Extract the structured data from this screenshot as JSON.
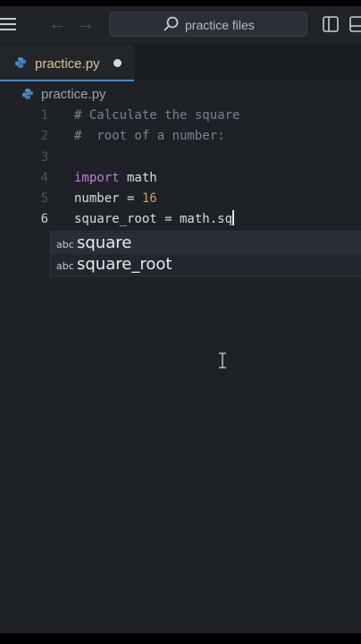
{
  "titlebar": {
    "search_text": "practice files"
  },
  "tab": {
    "label": "practice.py"
  },
  "breadcrumb": {
    "label": "practice.py"
  },
  "editor": {
    "lines": [
      {
        "no": "1",
        "tokens": [
          {
            "t": "comment",
            "v": "# Calculate the square"
          }
        ]
      },
      {
        "no": "2",
        "tokens": [
          {
            "t": "comment",
            "v": "#  root of a number:"
          }
        ]
      },
      {
        "no": "3",
        "tokens": []
      },
      {
        "no": "4",
        "tokens": [
          {
            "t": "keyword",
            "v": "import"
          },
          {
            "t": "plain",
            "v": " math"
          }
        ]
      },
      {
        "no": "5",
        "tokens": [
          {
            "t": "plain",
            "v": "number = "
          },
          {
            "t": "number",
            "v": "16"
          }
        ]
      },
      {
        "no": "6",
        "tokens": [
          {
            "t": "plain",
            "v": "square_root = math.sq"
          }
        ],
        "active": true
      }
    ]
  },
  "suggestions": [
    {
      "kind": "abc",
      "label": "square",
      "selected": true
    },
    {
      "kind": "abc",
      "label": "square_root",
      "selected": false
    }
  ],
  "colors": {
    "background": "#1e2227",
    "keyword": "#c678dd",
    "number": "#d19a66",
    "comment": "#7b828d",
    "tab_label": "#e2c08d",
    "accent": "#4e89c8"
  },
  "icons": [
    "menu-icon",
    "back-arrow-icon",
    "forward-arrow-icon",
    "search-icon",
    "layout-icon",
    "panel-icon",
    "python-file-icon",
    "unsaved-dot-icon",
    "text-cursor-icon"
  ]
}
